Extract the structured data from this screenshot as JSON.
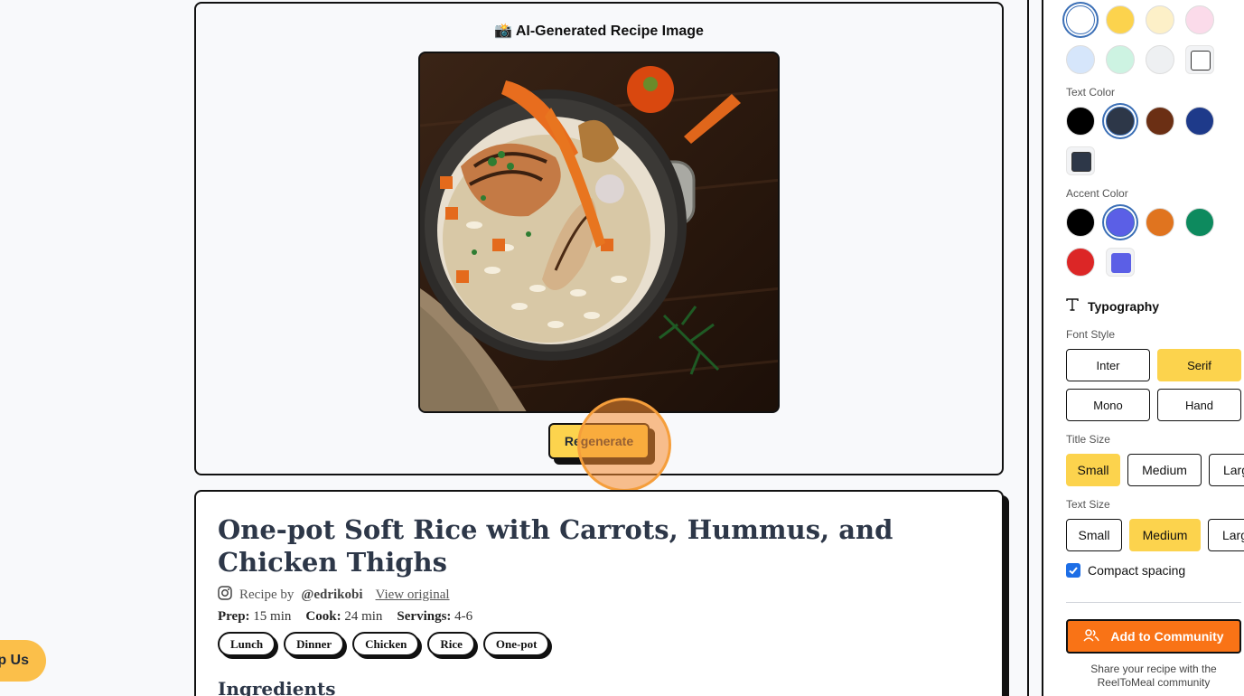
{
  "help_pill": {
    "label": "p Us"
  },
  "image_card": {
    "title": "📸 AI-Generated Recipe Image",
    "regenerate_label": "Regenerate"
  },
  "recipe": {
    "title": "One-pot Soft Rice with Carrots, Hummus, and Chicken Thighs",
    "byline_prefix": "Recipe by",
    "author_handle": "@edrikobi",
    "view_original": "View original",
    "prep_label": "Prep:",
    "prep_value": "15 min",
    "cook_label": "Cook:",
    "cook_value": "24 min",
    "servings_label": "Servings:",
    "servings_value": "4-6",
    "tags": [
      "Lunch",
      "Dinner",
      "Chicken",
      "Rice",
      "One-pot"
    ],
    "ingredients_heading": "Ingredients"
  },
  "panel": {
    "background_swatches": [
      "#ffffff",
      "#fcd34d",
      "#fdf0c8",
      "#fbdbea",
      "#d6e6fb",
      "#cdf3e2",
      "#eef0f2"
    ],
    "text_color_label": "Text Color",
    "text_swatches": [
      "#000000",
      "#2d3748",
      "#6b2f14",
      "#1e3a8a"
    ],
    "text_custom_color": "#2d3748",
    "accent_color_label": "Accent Color",
    "accent_swatches": [
      "#000000",
      "#5b5fe6",
      "#e0741f",
      "#0d8a5e",
      "#dc2626"
    ],
    "accent_custom_color": "#5b5fe6",
    "typography_title": "Typography",
    "font_style_label": "Font Style",
    "font_styles": [
      "Inter",
      "Serif",
      "Mono",
      "Hand"
    ],
    "font_style_selected": "Serif",
    "title_size_label": "Title Size",
    "title_sizes": [
      "Small",
      "Medium",
      "Larg"
    ],
    "text_size_label": "Text Size",
    "text_sizes": [
      "Small",
      "Medium",
      "Larg"
    ],
    "compact_label": "Compact spacing",
    "community_button": "Add to Community",
    "share_note": "Share your recipe with the ReelToMeal community"
  }
}
